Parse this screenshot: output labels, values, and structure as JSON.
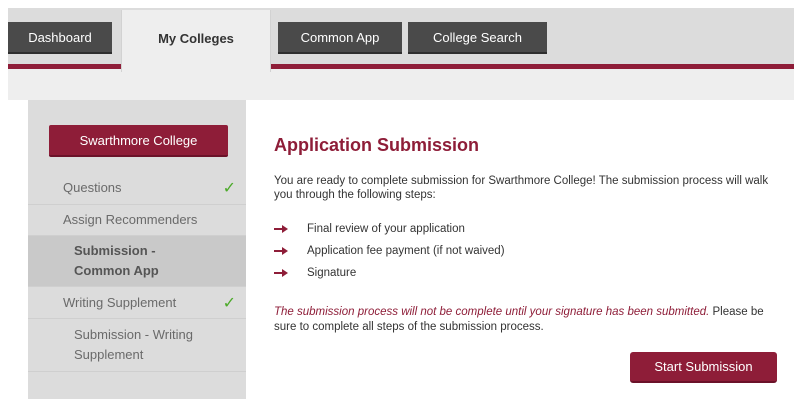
{
  "nav": {
    "tabs": [
      {
        "label": "Dashboard"
      },
      {
        "label": "My Colleges"
      },
      {
        "label": "Common App"
      },
      {
        "label": "College Search"
      }
    ],
    "active_tab": "My Colleges"
  },
  "sidebar": {
    "college_button": "Swarthmore College",
    "items": [
      {
        "label": "Questions",
        "checked": true
      },
      {
        "label": "Assign Recommenders",
        "checked": false
      },
      {
        "label": "Submission - Common App",
        "active": true
      },
      {
        "label": "Writing Supplement",
        "checked": true
      },
      {
        "label": "Submission - Writing Supplement",
        "checked": false
      }
    ],
    "check_glyph": "✓"
  },
  "main": {
    "title": "Application Submission",
    "intro": "You are ready to complete submission for Swarthmore College! The submission process will walk you through the following steps:",
    "steps": [
      "Final review of your application",
      "Application fee payment (if not waived)",
      "Signature"
    ],
    "note_emphasis": "The submission process will not be complete until your signature has been submitted.",
    "note_rest": " Please be sure to complete all steps of the submission process.",
    "start_button": "Start Submission"
  },
  "colors": {
    "brand": "#8e1d38",
    "tab_dark": "#4a4a4a",
    "check": "#4caa2a"
  },
  "icons": {
    "step_bullet": "arrow-right-icon",
    "completed": "checkmark-icon"
  }
}
